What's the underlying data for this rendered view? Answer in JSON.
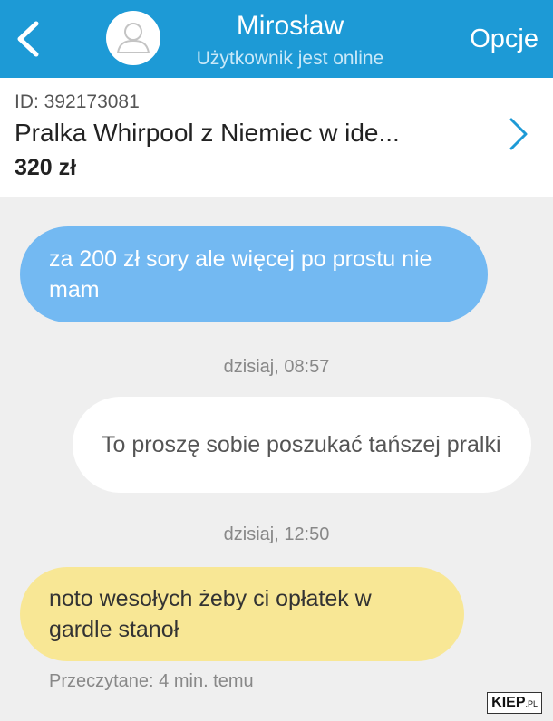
{
  "header": {
    "name": "Mirosław",
    "status": "Użytkownik jest online",
    "options_label": "Opcje",
    "background_color": "#1d9ad6"
  },
  "listing": {
    "id_label": "ID: 392173081",
    "title": "Pralka Whirpool z Niemiec w ide...",
    "price": "320 zł"
  },
  "messages": [
    {
      "text": "za 200 zł sory ale więcej po prostu nie mam",
      "color": "#73b9f2"
    },
    {
      "timestamp": "dzisiaj, 08:57",
      "text": "To proszę sobie poszukać tańszej pralki",
      "color": "#ffffff"
    },
    {
      "timestamp": "dzisiaj, 12:50",
      "text": "noto wesołych żeby ci opłatek w gardle stanoł",
      "color": "#f8e795"
    }
  ],
  "read_status": "Przeczytane: 4 min. temu",
  "watermark": {
    "main": "KIEP",
    "suffix": ".PL"
  },
  "icons": [
    "chevron-left-icon",
    "user-icon",
    "chevron-right-icon"
  ]
}
